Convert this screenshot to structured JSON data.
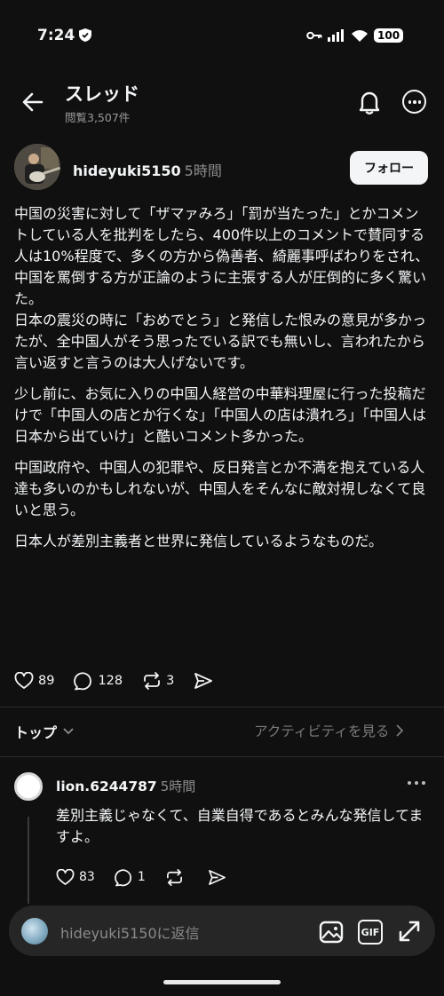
{
  "status_bar": {
    "time": "7:24",
    "battery": "100"
  },
  "header": {
    "title": "スレッド",
    "views": "閲覧3,507件"
  },
  "post": {
    "author": "hideyuki5150",
    "time": "5時間",
    "follow_label": "フォロー",
    "paragraphs": [
      "中国の災害に対して「ザマァみろ」「罰が当たった」とかコメントしている人を批判をしたら、400件以上のコメントで賛同する人は10%程度で、多くの方から偽善者、綺麗事呼ばわりをされ、中国を罵倒する方が正論のように主張する人が圧倒的に多く驚いた。\n日本の震災の時に「おめでとう」と発信した恨みの意見が多かったが、全中国人がそう思ったでいる訳でも無いし、言われたから言い返すと言うのは大人げないです。",
      "少し前に、お気に入りの中国人経営の中華料理屋に行った投稿だけで「中国人の店とか行くな」「中国人の店は潰れろ」「中国人は日本から出ていけ」と酷いコメント多かった。",
      "中国政府や、中国人の犯罪や、反日発言とか不満を抱えている人達も多いのかもしれないが、中国人をそんなに敵対視しなくて良いと思う。",
      "日本人が差別主義者と世界に発信しているようなものだ。"
    ],
    "likes": "89",
    "replies": "128",
    "reposts": "3"
  },
  "tabs": {
    "top_label": "トップ",
    "activity_label": "アクティビティを見る"
  },
  "reply": {
    "author": "lion.6244787",
    "time": "5時間",
    "text": "差別主義じゃなくて、自業自得であるとみんな発信してますよ。",
    "likes": "83",
    "replies": "1"
  },
  "composer": {
    "placeholder": "hideyuki5150に返信",
    "gif_label": "GIF"
  }
}
